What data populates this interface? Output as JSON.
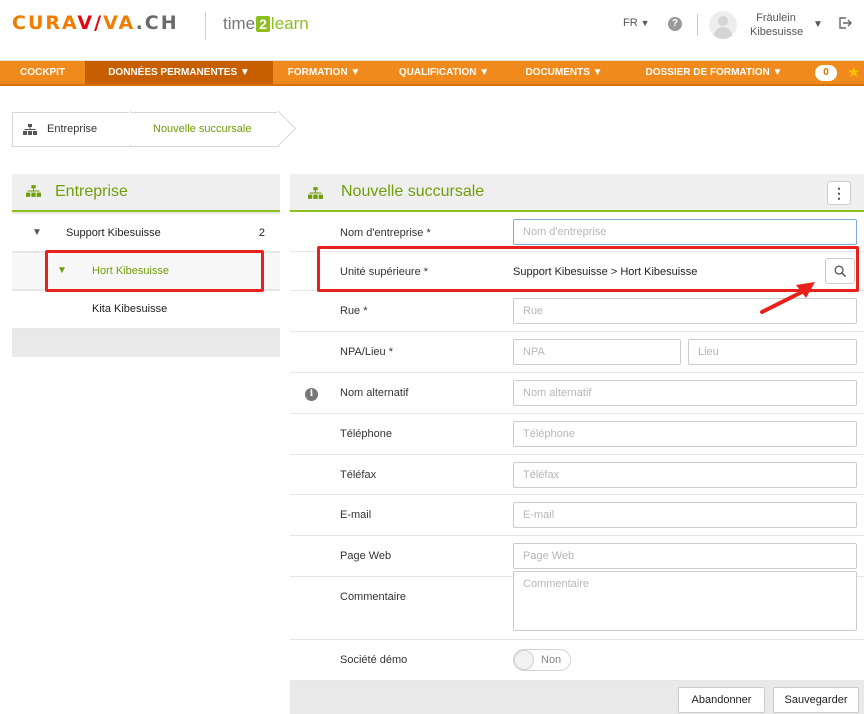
{
  "header": {
    "logo_left": {
      "part1": "CURA",
      "slash": "V/",
      "part2": "VA",
      "suffix": ".CH"
    },
    "logo_right": {
      "prefix": "time",
      "two": "2",
      "suffix": "learn"
    },
    "language": "FR",
    "user_name_line1": "Fräulein",
    "user_name_line2": "Kibesuisse"
  },
  "nav": {
    "items": [
      {
        "label": "COCKPIT"
      },
      {
        "label": "DONNÉES PERMANENTES ▼"
      },
      {
        "label": "FORMATION ▼"
      },
      {
        "label": "QUALIFICATION ▼"
      },
      {
        "label": "DOCUMENTS ▼"
      },
      {
        "label": "DOSSIER DE FORMATION ▼"
      }
    ],
    "badge": "0"
  },
  "breadcrumb": {
    "items": [
      {
        "label": "Entreprise"
      },
      {
        "label": "Nouvelle succursale"
      }
    ]
  },
  "left_panel": {
    "title": "Entreprise",
    "tree": [
      {
        "label": "Support Kibesuisse",
        "count": "2"
      },
      {
        "label": "Hort Kibesuisse"
      },
      {
        "label": "Kita Kibesuisse"
      }
    ]
  },
  "form": {
    "title": "Nouvelle succursale",
    "company_name": {
      "label": "Nom d'entreprise *",
      "placeholder": "Nom d'entreprise"
    },
    "parent_unit": {
      "label": "Unité supérieure *",
      "value": "Support Kibesuisse > Hort Kibesuisse"
    },
    "street": {
      "label": "Rue *",
      "placeholder": "Rue"
    },
    "npa_city": {
      "label": "NPA/Lieu *",
      "npa_placeholder": "NPA",
      "city_placeholder": "Lieu"
    },
    "alt_name": {
      "label": "Nom alternatif",
      "placeholder": "Nom alternatif"
    },
    "phone": {
      "label": "Téléphone",
      "placeholder": "Téléphone"
    },
    "fax": {
      "label": "Téléfax",
      "placeholder": "Téléfax"
    },
    "email": {
      "label": "E-mail",
      "placeholder": "E-mail"
    },
    "website": {
      "label": "Page Web",
      "placeholder": "Page Web"
    },
    "comment": {
      "label": "Commentaire",
      "placeholder": "Commentaire"
    },
    "demo": {
      "label": "Société démo",
      "toggle_text": "Non"
    },
    "cancel_label": "Abandonner",
    "save_label": "Sauvegarder"
  },
  "colors": {
    "nav_orange": "#f08a1c",
    "nav_active": "#c75f00",
    "accent_green": "#8dbf1f",
    "title_green": "#6f9e0a",
    "highlight_red": "#e8221a"
  }
}
